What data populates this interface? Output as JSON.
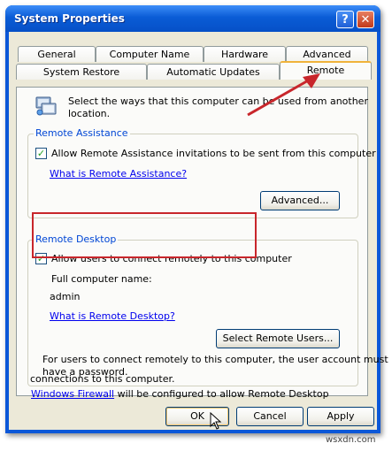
{
  "window": {
    "title": "System Properties"
  },
  "tabs_row1": [
    "General",
    "Computer Name",
    "Hardware",
    "Advanced"
  ],
  "tabs_row2": [
    "System Restore",
    "Automatic Updates",
    "Remote"
  ],
  "intro_text": [
    "Select the ways that this computer can be used from another",
    "location."
  ],
  "remote_assistance": {
    "legend": "Remote Assistance",
    "checkbox_label": "Allow Remote Assistance invitations to be sent from this computer",
    "checked": true,
    "link": "What is Remote Assistance?",
    "advanced_button": "Advanced..."
  },
  "remote_desktop": {
    "legend": "Remote Desktop",
    "checkbox_label": "Allow users to connect remotely to this computer",
    "checked": true,
    "full_name_label": "Full computer name:",
    "computer_name": "admin",
    "link": "What is Remote Desktop?",
    "select_users_button": "Select Remote Users...",
    "info_text": [
      "For users to connect remotely to this computer, the user account must",
      "have a password."
    ],
    "firewall_link": "Windows Firewall",
    "firewall_text_1": " will be configured to allow Remote Desktop",
    "firewall_text_2": "connections to this computer."
  },
  "buttons": {
    "ok": "OK",
    "cancel": "Cancel",
    "apply": "Apply"
  },
  "watermark": "wsxdn.com",
  "colors": {
    "titlebar": "#0a5cd6",
    "annotation": "#c8262b",
    "link": "#0000ee",
    "legend": "#0046d5"
  }
}
